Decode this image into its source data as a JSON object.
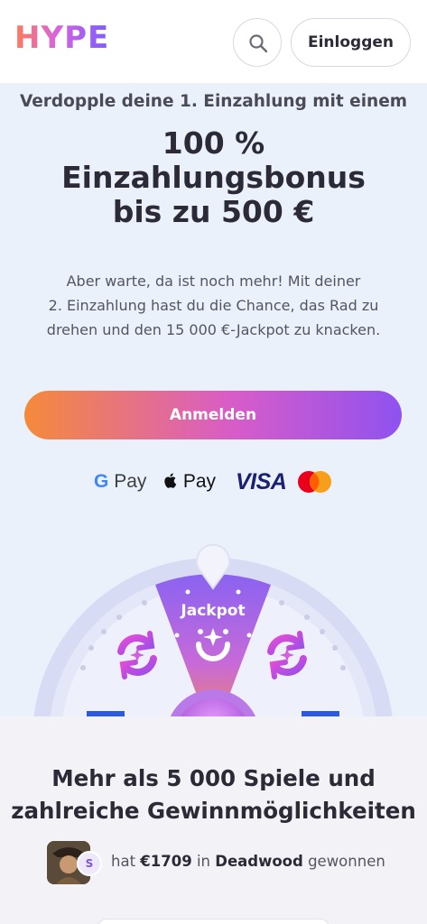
{
  "header": {
    "logo": "HYPE",
    "search_icon": "search-icon",
    "login_label": "Einloggen"
  },
  "promo": {
    "intro": "Verdopple deine 1. Einzahlung mit einem",
    "title_line1": "100 %",
    "title_line2": "Einzahlungsbonus",
    "title_line3": "bis zu 500 €",
    "desc_line1": "Aber warte, da ist noch mehr! Mit deiner",
    "desc_line2": "2. Einzahlung hast du die Chance, das Rad zu",
    "desc_line3": "drehen und den 15 000 €-Jackpot zu knacken.",
    "cta_label": "Anmelden"
  },
  "payments": {
    "gpay_g": "G",
    "gpay_text": "Pay",
    "apple_text": "Pay",
    "visa_text": "VISA",
    "methods": [
      "google-pay-icon",
      "apple-pay-icon",
      "visa-icon",
      "mastercard-icon"
    ]
  },
  "wheel": {
    "jackpot_label": "Jackpot"
  },
  "games": {
    "title_line1": "Mehr als 5 000 Spiele und",
    "title_line2": "zahlreiche Gewinnmöglichkeiten",
    "win": {
      "avatar_initial": "S",
      "prefix": "hat",
      "amount": "€1709",
      "mid": "in",
      "game": "Deadwood",
      "suffix": "gewonnen"
    }
  },
  "colors": {
    "accent_gradient": [
      "#f58a3a",
      "#d85cc8",
      "#8f52f0"
    ],
    "page_bg": "#eaf1fb",
    "text_dark": "#2b2a36"
  }
}
